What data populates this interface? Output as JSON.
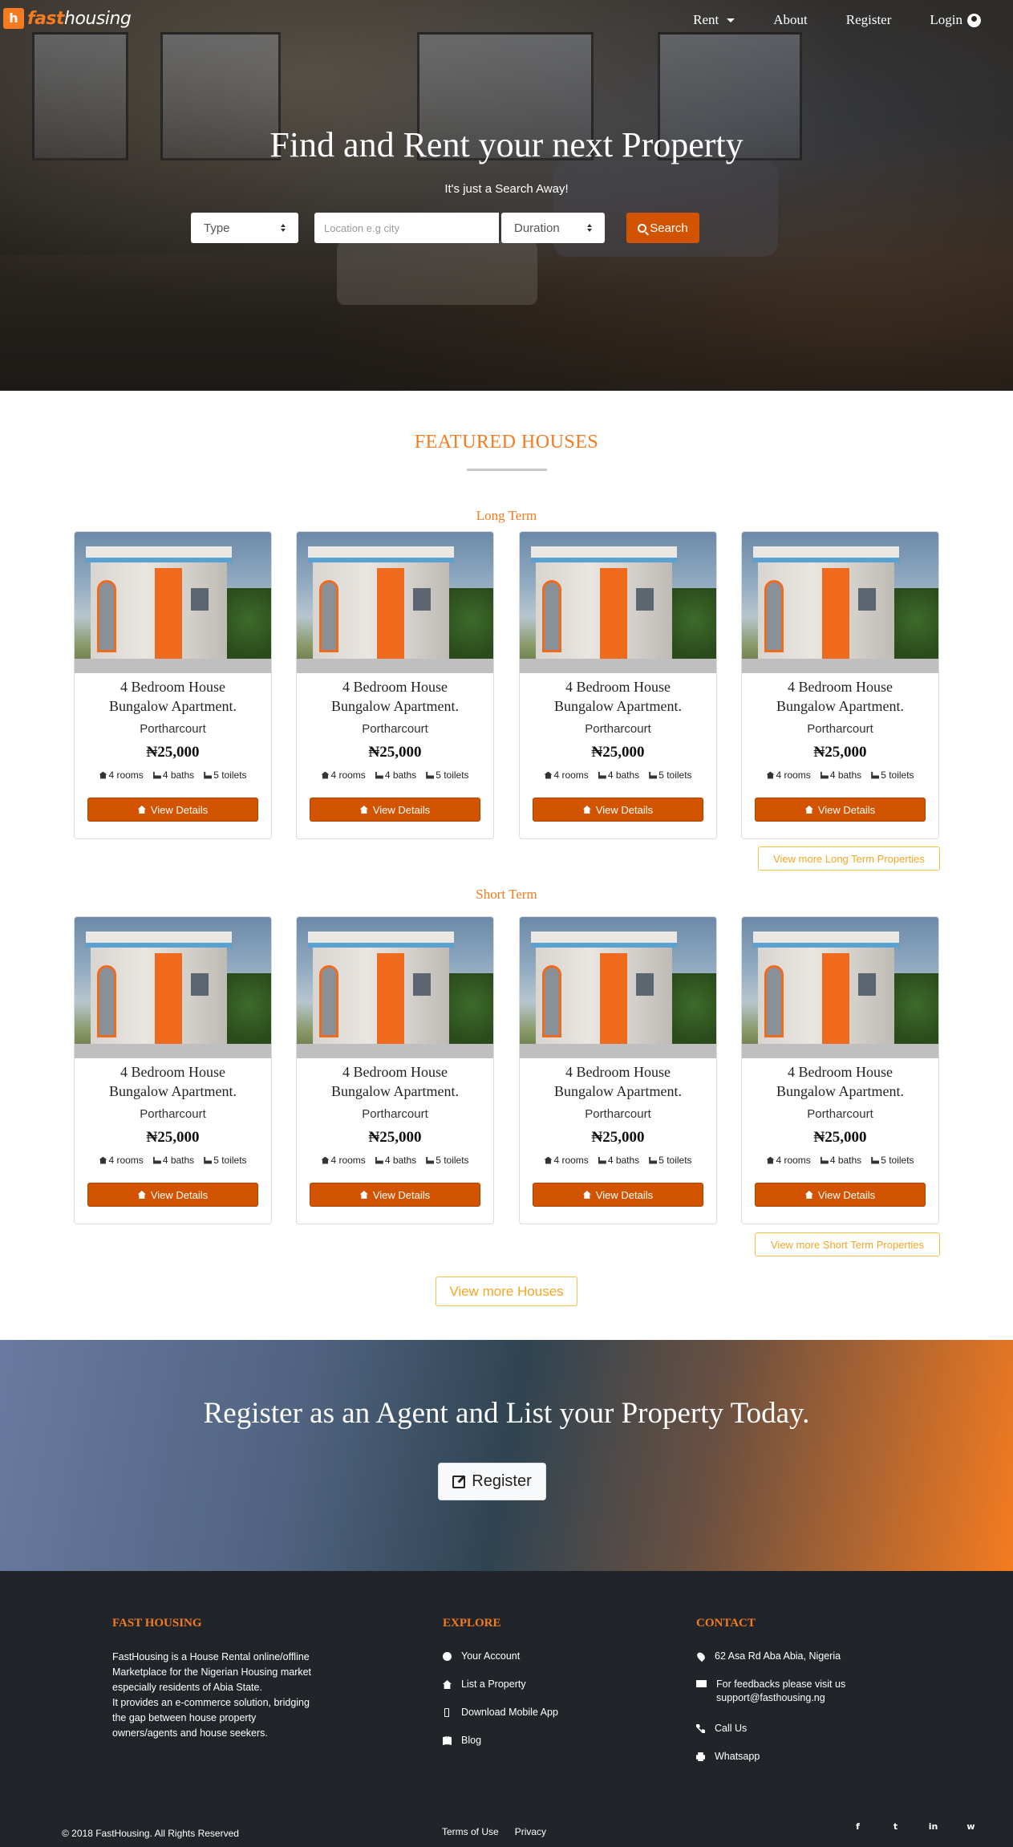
{
  "brand": {
    "fast": "fast",
    "housing": "housing",
    "mark": "h"
  },
  "nav": {
    "rent": "Rent",
    "about": "About",
    "register": "Register",
    "login": "Login"
  },
  "hero": {
    "title": "Find and Rent your next Property",
    "subtitle": "It's just a Search Away!",
    "type_select": "Type",
    "location_placeholder": "Location e.g city",
    "duration_select": "Duration",
    "search_label": "Search"
  },
  "featured": {
    "title": "FEATURED HOUSES",
    "long_term_label": "Long Term",
    "short_term_label": "Short Term",
    "view_more_long": "View more Long Term Properties",
    "view_more_short": "View more Short Term Properties",
    "view_more_houses": "View more Houses",
    "long_term": [
      {
        "title_line1": "4 Bedroom House",
        "title_line2": "Bungalow Apartment.",
        "location": "Portharcourt",
        "price": "₦25,000",
        "rooms": "4 rooms",
        "baths": "4 baths",
        "toilets": "5 toilets",
        "button": "View Details"
      },
      {
        "title_line1": "4 Bedroom House",
        "title_line2": "Bungalow Apartment.",
        "location": "Portharcourt",
        "price": "₦25,000",
        "rooms": "4 rooms",
        "baths": "4 baths",
        "toilets": "5 toilets",
        "button": "View Details"
      },
      {
        "title_line1": "4 Bedroom House",
        "title_line2": "Bungalow Apartment.",
        "location": "Portharcourt",
        "price": "₦25,000",
        "rooms": "4 rooms",
        "baths": "4 baths",
        "toilets": "5 toilets",
        "button": "View Details"
      },
      {
        "title_line1": "4 Bedroom House",
        "title_line2": "Bungalow Apartment.",
        "location": "Portharcourt",
        "price": "₦25,000",
        "rooms": "4 rooms",
        "baths": "4 baths",
        "toilets": "5 toilets",
        "button": "View Details"
      }
    ],
    "short_term": [
      {
        "title_line1": "4 Bedroom House",
        "title_line2": "Bungalow Apartment.",
        "location": "Portharcourt",
        "price": "₦25,000",
        "rooms": "4 rooms",
        "baths": "4 baths",
        "toilets": "5 toilets",
        "button": "View Details"
      },
      {
        "title_line1": "4 Bedroom House",
        "title_line2": "Bungalow Apartment.",
        "location": "Portharcourt",
        "price": "₦25,000",
        "rooms": "4 rooms",
        "baths": "4 baths",
        "toilets": "5 toilets",
        "button": "View Details"
      },
      {
        "title_line1": "4 Bedroom House",
        "title_line2": "Bungalow Apartment.",
        "location": "Portharcourt",
        "price": "₦25,000",
        "rooms": "4 rooms",
        "baths": "4 baths",
        "toilets": "5 toilets",
        "button": "View Details"
      },
      {
        "title_line1": "4 Bedroom House",
        "title_line2": "Bungalow Apartment.",
        "location": "Portharcourt",
        "price": "₦25,000",
        "rooms": "4 rooms",
        "baths": "4 baths",
        "toilets": "5 toilets",
        "button": "View Details"
      }
    ]
  },
  "cta": {
    "title": "Register as an Agent and List your Property Today.",
    "button": "Register"
  },
  "footer": {
    "about_head": "FAST HOUSING",
    "about_p1": "FastHousing is a House Rental online/offline Marketplace for the Nigerian Housing market especially residents of Abia State.",
    "about_p2": "It provides an e-commerce solution, bridging the gap between house property owners/agents and house seekers.",
    "explore_head": "EXPLORE",
    "explore": [
      {
        "label": "Your Account",
        "icon": "user-circle-icon"
      },
      {
        "label": "List a Property",
        "icon": "house-icon"
      },
      {
        "label": "Download Mobile App",
        "icon": "mobile-icon"
      },
      {
        "label": "Blog",
        "icon": "book-icon"
      }
    ],
    "contact_head": "CONTACT",
    "contact": [
      {
        "label": "62 Asa Rd Aba Abia, Nigeria",
        "icon": "map-pin-icon"
      },
      {
        "label": "For feedbacks please visit us support@fasthousing.ng",
        "icon": "mail-icon"
      },
      {
        "label": "Call Us",
        "icon": "phone-icon"
      },
      {
        "label": "Whatsapp",
        "icon": "print-icon"
      }
    ],
    "copyright": "© 2018 FastHousing. All Rights Reserved",
    "terms": "Terms of Use",
    "privacy": "Privacy",
    "social": [
      "f",
      "t",
      "in",
      "w"
    ]
  },
  "colors": {
    "accent": "#f47b20",
    "button": "#d35400",
    "footer_bg": "#212529",
    "outline": "#f5c242"
  }
}
